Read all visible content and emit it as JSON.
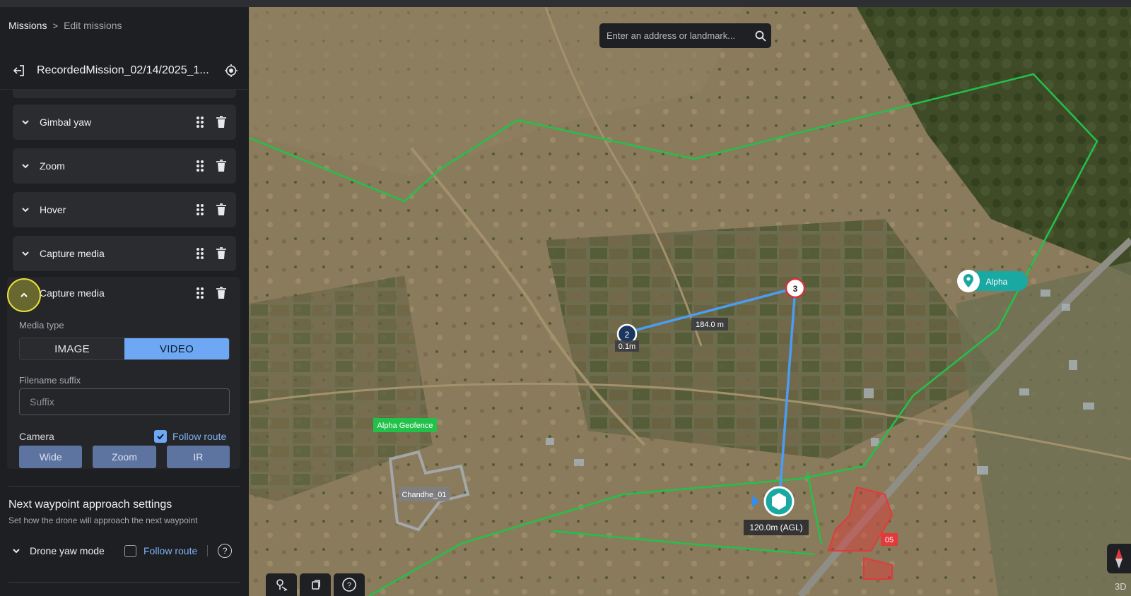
{
  "breadcrumb": {
    "root": "Missions",
    "separator": ">",
    "current": "Edit missions"
  },
  "mission": {
    "title": "RecordedMission_02/14/2025_1..."
  },
  "actions": [
    {
      "label": "Gimbal yaw"
    },
    {
      "label": "Zoom"
    },
    {
      "label": "Hover"
    },
    {
      "label": "Capture media"
    }
  ],
  "expanded_action": {
    "label": "Capture media",
    "media_type_label": "Media type",
    "media_options": [
      "IMAGE",
      "VIDEO"
    ],
    "media_selected": "VIDEO",
    "filename_label": "Filename suffix",
    "filename_placeholder": "Suffix",
    "camera_label": "Camera",
    "follow_route_label": "Follow route",
    "follow_route_checked": true,
    "cameras": [
      "Wide",
      "Zoom",
      "IR"
    ]
  },
  "approach": {
    "title": "Next waypoint approach settings",
    "subtitle": "Set how the drone will approach the next waypoint",
    "yaw_label": "Drone yaw mode",
    "follow_route_label": "Follow route",
    "follow_route_checked": false,
    "help_icon": "?"
  },
  "map": {
    "search_placeholder": "Enter an address or landmark...",
    "waypoint_2": "2",
    "waypoint_3": "3",
    "waypoint_2_height": "0.1m",
    "distance_label": "184.0 m",
    "dock_label": "120.0m (AGL)",
    "geofence_label": "Alpha Geofence",
    "area_label": "Chandhe_01",
    "poi_label": "Alpha",
    "zone_label": "05",
    "label_3d": "3D",
    "colors": {
      "geofence": "#22c24a",
      "route": "#4a9df0",
      "restricted": "#e23a3a",
      "accent": "#6ea8f5"
    }
  }
}
